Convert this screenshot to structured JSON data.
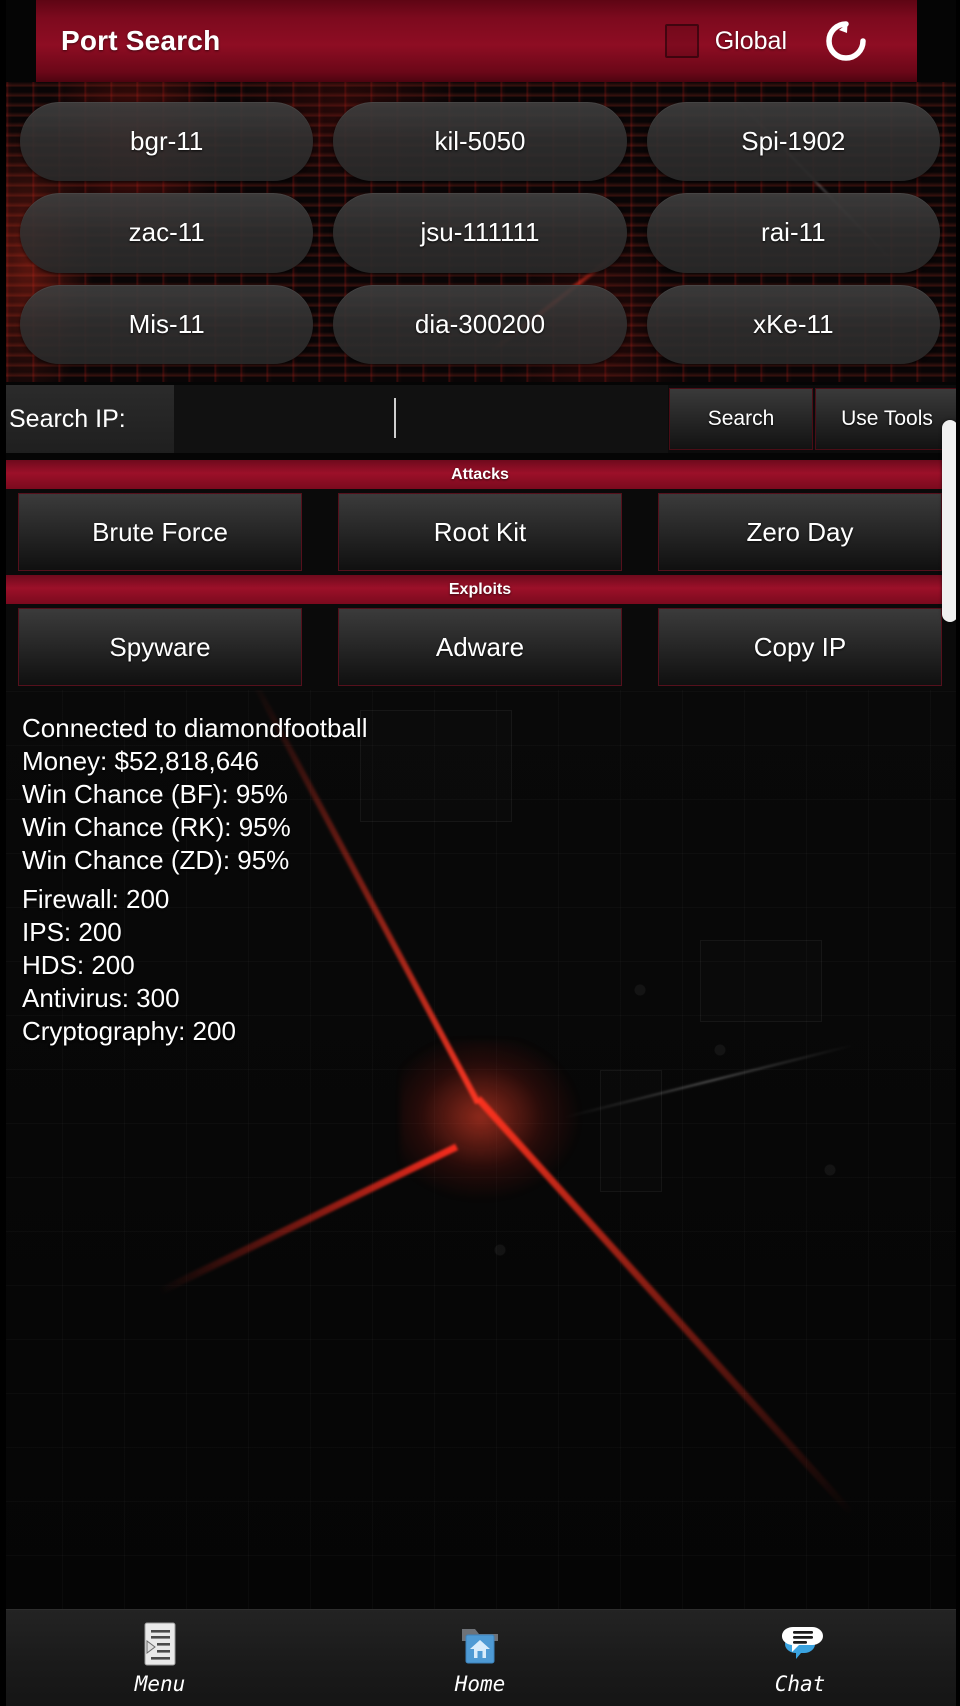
{
  "header": {
    "title": "Port Search",
    "global_label": "Global",
    "global_checked": false,
    "refresh_icon": "refresh-icon",
    "accent_color": "#8e0d23"
  },
  "ports": [
    {
      "label": "bgr-11"
    },
    {
      "label": "kil-5050"
    },
    {
      "label": "Spi-1902"
    },
    {
      "label": "zac-11"
    },
    {
      "label": "jsu-111111"
    },
    {
      "label": "rai-11"
    },
    {
      "label": "Mis-11"
    },
    {
      "label": "dia-300200"
    },
    {
      "label": "xKe-11"
    }
  ],
  "search": {
    "label": "Search IP:",
    "value": "",
    "placeholder": "",
    "search_button": "Search",
    "tools_button": "Use Tools"
  },
  "sections": [
    {
      "title": "Attacks",
      "buttons": [
        {
          "label": "Brute Force"
        },
        {
          "label": "Root Kit"
        },
        {
          "label": "Zero Day"
        }
      ]
    },
    {
      "title": "Exploits",
      "buttons": [
        {
          "label": "Spyware"
        },
        {
          "label": "Adware"
        },
        {
          "label": "Copy IP"
        }
      ]
    }
  ],
  "console": {
    "lines": [
      "Connected to diamondfootball",
      "Money: $52,818,646",
      "Win Chance (BF): 95%",
      "Win Chance (RK): 95%",
      "Win Chance (ZD): 95%"
    ],
    "stats": [
      "Firewall: 200",
      "IPS: 200",
      "HDS: 200",
      "Antivirus: 300",
      "Cryptography: 200"
    ]
  },
  "bottom_nav": [
    {
      "label": "Menu",
      "icon": "menu-list-icon"
    },
    {
      "label": "Home",
      "icon": "home-folder-icon"
    },
    {
      "label": "Chat",
      "icon": "chat-bubbles-icon"
    }
  ]
}
